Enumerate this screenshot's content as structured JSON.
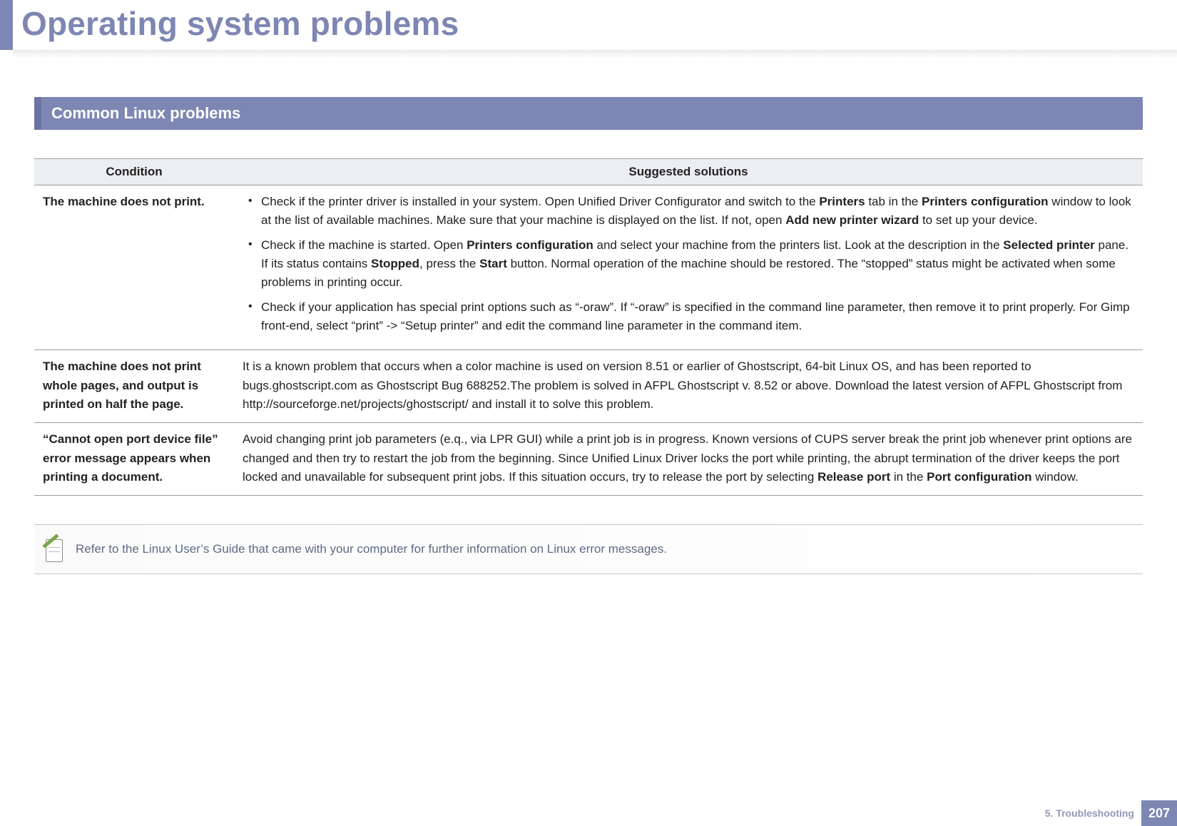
{
  "header": {
    "title": "Operating system problems"
  },
  "section": {
    "title": "Common Linux problems"
  },
  "table": {
    "headers": {
      "condition": "Condition",
      "solutions": "Suggested solutions"
    },
    "rows": [
      {
        "condition": "The machine does not print.",
        "bullets": [
          {
            "pre": "Check if the printer driver is installed in your system. Open Unified Driver Configurator and switch to the ",
            "b1": "Printers",
            "mid1": " tab in the ",
            "b2": "Printers configuration",
            "mid2": " window to look at the list of available machines. Make sure that your machine is displayed on the list. If not, open ",
            "b3": "Add new printer wizard",
            "post": " to set up your device."
          },
          {
            "pre": "Check if the machine is started. Open ",
            "b1": "Printers configuration",
            "mid1": " and select your machine from the printers list. Look at the description in the ",
            "b2": "Selected printer",
            "mid2": " pane. If its status contains ",
            "b3": "Stopped",
            "mid3": ", press the ",
            "b4": "Start",
            "post": " button. Normal operation of the machine should be restored. The “stopped” status might be activated when some problems in printing occur."
          },
          {
            "pre": "Check if your application has special print options such as “-oraw”. If “-oraw” is specified in the command line parameter, then remove it to print properly. For Gimp front-end, select “print” -> “Setup printer” and edit the command line parameter in the command item.",
            "b1": "",
            "mid1": "",
            "b2": "",
            "mid2": "",
            "b3": "",
            "mid3": "",
            "b4": "",
            "post": ""
          }
        ]
      },
      {
        "condition": "The machine does not print whole pages, and output is printed on half the page.",
        "text": "It is a known problem that occurs when a color machine is used on version 8.51 or earlier of Ghostscript, 64-bit Linux OS, and has been reported to bugs.ghostscript.com as Ghostscript Bug 688252.The problem is solved in AFPL Ghostscript v. 8.52 or above. Download the latest version of AFPL Ghostscript from http://sourceforge.net/projects/ghostscript/ and install it to solve this problem."
      },
      {
        "condition": "“Cannot open port device file” error message appears when printing a document.",
        "text_pre": "Avoid changing print job parameters (e.q., via LPR GUI) while a print job is in progress. Known versions of CUPS server break the print job whenever print options are changed and then try to restart the job from the beginning. Since Unified Linux Driver locks the port while printing, the abrupt termination of the driver keeps the port locked and unavailable for subsequent print jobs. If this situation occurs, try to release the port by selecting ",
        "text_b1": "Release port",
        "text_mid": " in the ",
        "text_b2": "Port configuration",
        "text_post": " window."
      }
    ]
  },
  "note": {
    "text": "Refer to the Linux User’s Guide that came with your computer for further information on Linux error messages."
  },
  "footer": {
    "chapter": "5.  Troubleshooting",
    "page": "207"
  }
}
